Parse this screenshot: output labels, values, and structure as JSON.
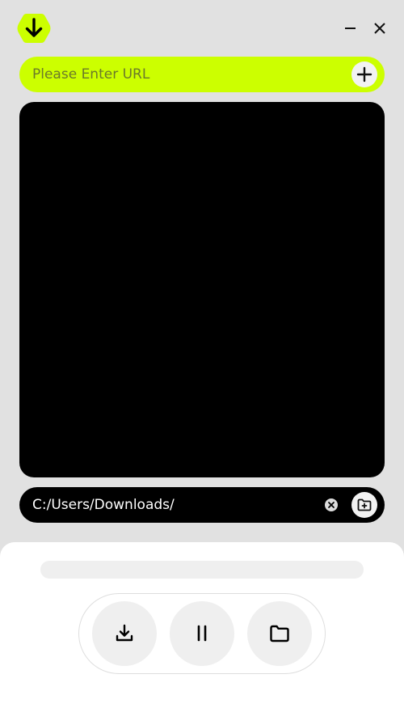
{
  "app": {
    "logo_icon": "download-arrow-hexagon-icon",
    "accent_color": "#ccff00"
  },
  "window_controls": {
    "minimize_icon": "minus-icon",
    "close_icon": "close-icon"
  },
  "url_bar": {
    "placeholder": "Please Enter URL",
    "value": "",
    "add_icon": "plus-icon"
  },
  "path_bar": {
    "path": "C:/Users/Downloads/",
    "clear_icon": "clear-x-icon",
    "browse_icon": "folder-plus-icon"
  },
  "progress": {
    "fraction": 0
  },
  "controls": {
    "download_icon": "download-icon",
    "pause_icon": "pause-icon",
    "folder_icon": "folder-icon"
  }
}
